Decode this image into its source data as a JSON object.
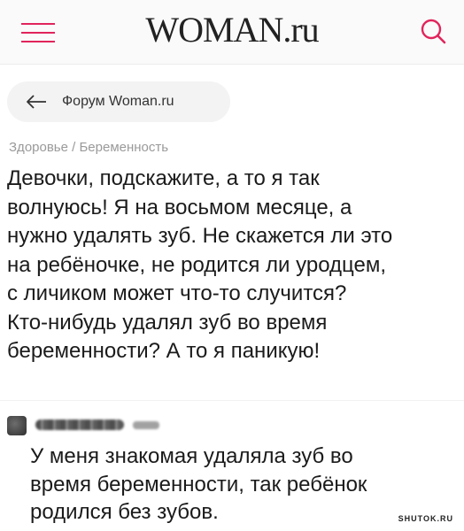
{
  "header": {
    "logo_text": "WOMAN.ru",
    "menu_icon": "hamburger-menu-icon",
    "search_icon": "search-icon",
    "accent_color": "#e1245b"
  },
  "back_link": {
    "label": "Форум Woman.ru",
    "icon": "arrow-left-icon"
  },
  "breadcrumb": "Здоровье / Беременность",
  "post": {
    "lines": [
      "Девочки, подскажите, а то я так",
      "волнуюсь! Я на восьмом месяце, а",
      "нужно удалять зуб. Не скажется ли это",
      "на ребёночке, не родится ли уродцем,",
      "с личиком может что-то случится?",
      "Кто-нибудь удалял зуб во время",
      "беременности? А то я паникую!"
    ]
  },
  "reply": {
    "lines": [
      "У меня знакомая удаляла зуб во",
      "время беременности, так ребёнок",
      "родился без зубов."
    ]
  },
  "watermark": "SHUTOK.RU"
}
